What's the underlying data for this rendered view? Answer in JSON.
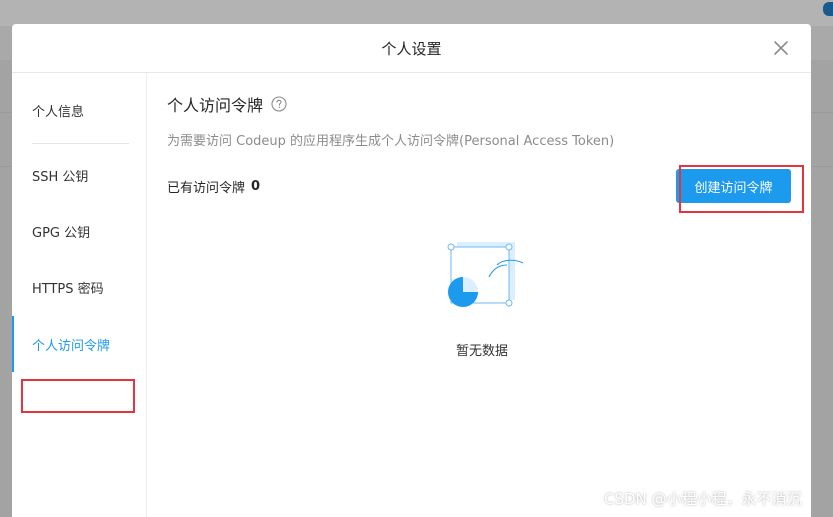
{
  "modal": {
    "title": "个人设置",
    "close_icon": "close-icon"
  },
  "sidebar": {
    "items": [
      {
        "label": "个人信息",
        "active": false
      },
      {
        "label": "SSH 公钥",
        "active": false
      },
      {
        "label": "GPG 公钥",
        "active": false
      },
      {
        "label": "HTTPS 密码",
        "active": false
      },
      {
        "label": "个人访问令牌",
        "active": true
      }
    ]
  },
  "content": {
    "title": "个人访问令牌",
    "help_icon": "question-circle-icon",
    "description": "为需要访问 Codeup 的应用程序生成个人访问令牌(Personal Access Token)",
    "count_label": "已有访问令牌",
    "count_value": "0",
    "create_button_label": "创建访问令牌",
    "empty_text": "暂无数据"
  },
  "colors": {
    "accent": "#1b9aee",
    "highlight": "#e5343d"
  },
  "watermark": "CSDN @小程小程，永不消沉"
}
